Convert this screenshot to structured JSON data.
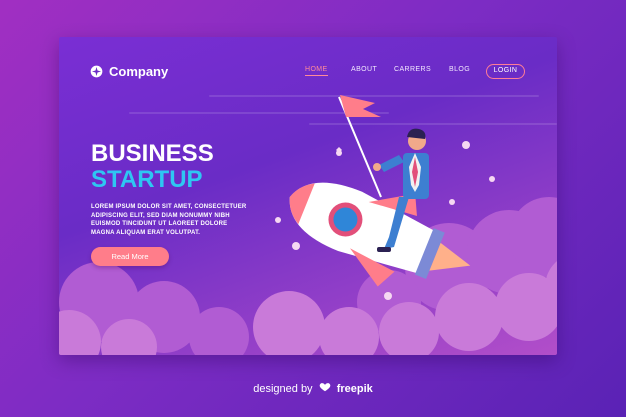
{
  "logo": {
    "icon": "company-logo-icon",
    "name": "Company"
  },
  "nav": {
    "items": [
      {
        "label": "HOME",
        "active": true
      },
      {
        "label": "ABOUT",
        "active": false
      },
      {
        "label": "CARRERS",
        "active": false
      },
      {
        "label": "BLOG",
        "active": false
      }
    ],
    "login_label": "LOGIN"
  },
  "hero": {
    "title_line1": "BUSINESS",
    "title_line2": "STARTUP",
    "body_lines": [
      "LOREM IPSUM DOLOR SIT AMET, CONSECTETUER",
      "ADIPISCING ELIT, SED DIAM NONUMMY NIBH",
      "EUISMOD TINCIDUNT UT LAOREET DOLORE",
      "MAGNA ALIQUAM ERAT VOLUTPAT."
    ],
    "cta_label": "Read More"
  },
  "illustration": {
    "icon": "businessman-on-rocket-illustration"
  },
  "footer": {
    "prefix": "designed by",
    "icon": "freepik-logo-icon",
    "brand": "freepik"
  },
  "colors": {
    "background": "#8a2fc6",
    "card": "#6a2cc6",
    "accent_blue": "#2ec7f2",
    "accent_pink": "#ff7d8a"
  }
}
